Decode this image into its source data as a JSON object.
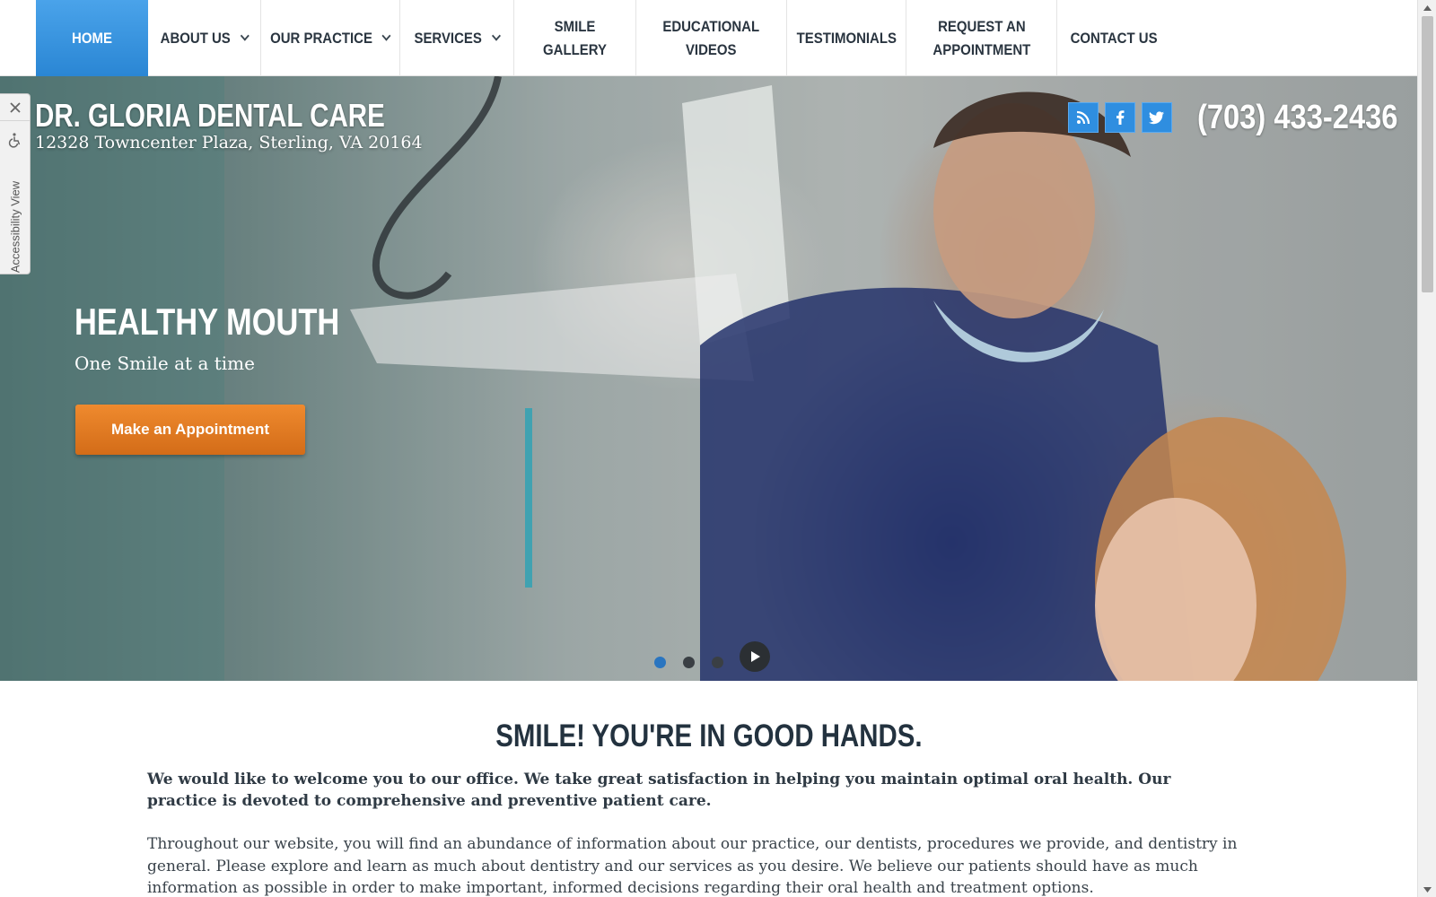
{
  "nav": {
    "items": [
      {
        "label": "HOME",
        "active": true,
        "dropdown": false
      },
      {
        "label": "ABOUT US",
        "active": false,
        "dropdown": true
      },
      {
        "label": "OUR PRACTICE",
        "active": false,
        "dropdown": true
      },
      {
        "label": "SERVICES",
        "active": false,
        "dropdown": true
      },
      {
        "label": "SMILE GALLERY",
        "active": false,
        "dropdown": false
      },
      {
        "label": "EDUCATIONAL\nVIDEOS",
        "active": false,
        "dropdown": false
      },
      {
        "label": "TESTIMONIALS",
        "active": false,
        "dropdown": false
      },
      {
        "label": "REQUEST AN\nAPPOINTMENT",
        "active": false,
        "dropdown": false
      },
      {
        "label": "CONTACT US",
        "active": false,
        "dropdown": false
      }
    ]
  },
  "header": {
    "practice_name": "DR. GLORIA DENTAL CARE",
    "address": "12328 Towncenter Plaza, Sterling, VA 20164",
    "phone": "(703) 433-2436",
    "social_icons": [
      "rss-icon",
      "facebook-icon",
      "twitter-icon"
    ]
  },
  "hero": {
    "title": "HEALTHY MOUTH",
    "subtitle": "One Smile at a time",
    "cta_label": "Make an Appointment",
    "slide_count": 3,
    "active_slide": 1
  },
  "accessibility": {
    "label": "Accessibility View"
  },
  "main": {
    "title": "SMILE! YOU'RE IN GOOD HANDS.",
    "intro": "We would like to welcome you to our office. We take great satisfaction in helping you maintain optimal oral health. Our practice is devoted to comprehensive and preventive patient care.",
    "body": "Throughout our website, you will find an abundance of information about our practice, our dentists, procedures we provide, and dentistry in general. Please explore and learn as much about dentistry and our services as you desire. We believe our patients should have as much information as possible in order to make important, informed decisions regarding their oral health and treatment options."
  },
  "colors": {
    "nav_active": "#2a86d4",
    "cta": "#e07a22",
    "social": "#2f8ee0",
    "heading": "#23323f"
  }
}
